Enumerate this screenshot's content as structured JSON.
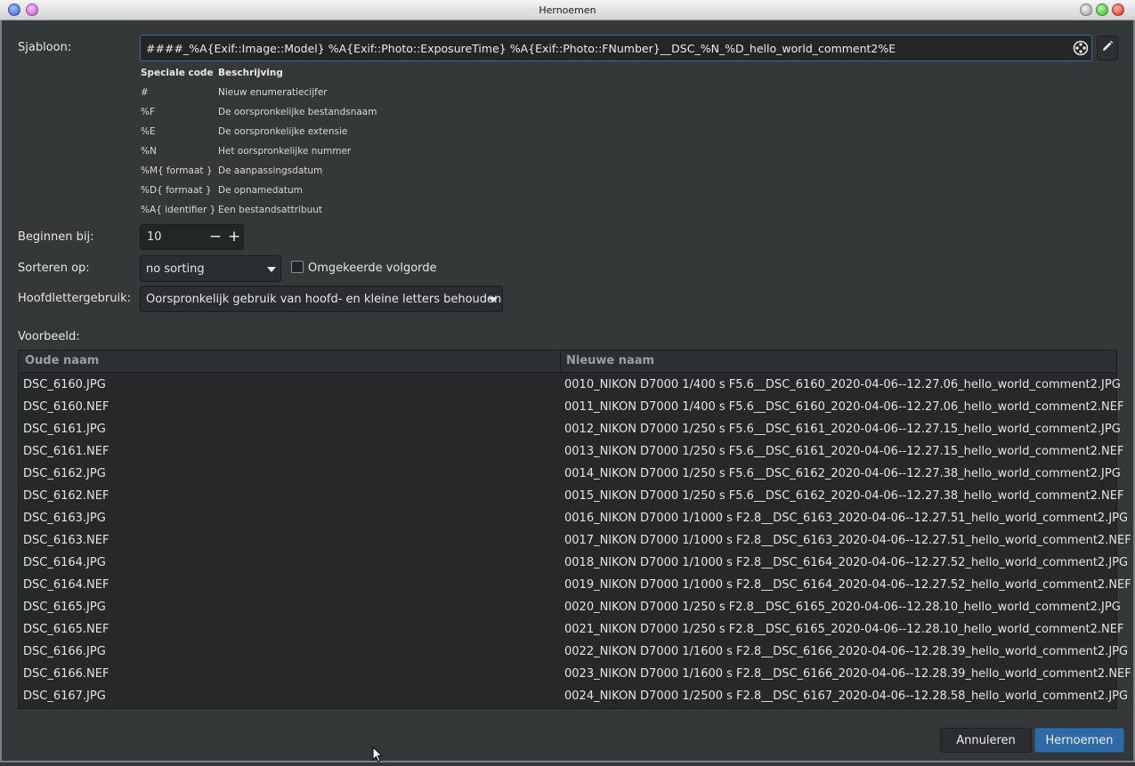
{
  "window": {
    "title": "Hernoemen"
  },
  "form": {
    "template_label": "Sjabloon:",
    "template_value": "####_%A{Exif::Image::Model} %A{Exif::Photo::ExposureTime} %A{Exif::Photo::FNumber}__DSC_%N_%D_hello_world_comment2%E",
    "start_label": "Beginnen bij:",
    "start_value": "10",
    "sort_label": "Sorteren op:",
    "sort_value": "no sorting",
    "reverse_label": "Omgekeerde volgorde",
    "reverse_checked": false,
    "case_label": "Hoofdlettergebruik:",
    "case_value": "Oorspronkelijk gebruik van hoofd- en kleine letters behouden",
    "preview_label": "Voorbeeld:"
  },
  "help": {
    "header_code": "Speciale code",
    "header_desc": "Beschrijving",
    "rows": [
      {
        "code": "#",
        "desc": "Nieuw enumeratiecijfer"
      },
      {
        "code": "%F",
        "desc": "De oorspronkelijke bestandsnaam"
      },
      {
        "code": "%E",
        "desc": "De oorspronkelijke extensie"
      },
      {
        "code": "%N",
        "desc": "Het oorspronkelijke nummer"
      },
      {
        "code": "%M{ formaat }",
        "desc": "De aanpassingsdatum"
      },
      {
        "code": "%D{ formaat }",
        "desc": "De opnamedatum"
      },
      {
        "code": "%A{ identifier }",
        "desc": "Een bestandsattribuut"
      }
    ]
  },
  "preview": {
    "col_old": "Oude naam",
    "col_new": "Nieuwe naam",
    "rows": [
      {
        "old": "DSC_6160.JPG",
        "new": "0010_NIKON D7000 1/400 s F5.6__DSC_6160_2020-04-06--12.27.06_hello_world_comment2.JPG"
      },
      {
        "old": "DSC_6160.NEF",
        "new": "0011_NIKON D7000 1/400 s F5.6__DSC_6160_2020-04-06--12.27.06_hello_world_comment2.NEF"
      },
      {
        "old": "DSC_6161.JPG",
        "new": "0012_NIKON D7000 1/250 s F5.6__DSC_6161_2020-04-06--12.27.15_hello_world_comment2.JPG"
      },
      {
        "old": "DSC_6161.NEF",
        "new": "0013_NIKON D7000 1/250 s F5.6__DSC_6161_2020-04-06--12.27.15_hello_world_comment2.NEF"
      },
      {
        "old": "DSC_6162.JPG",
        "new": "0014_NIKON D7000 1/250 s F5.6__DSC_6162_2020-04-06--12.27.38_hello_world_comment2.JPG"
      },
      {
        "old": "DSC_6162.NEF",
        "new": "0015_NIKON D7000 1/250 s F5.6__DSC_6162_2020-04-06--12.27.38_hello_world_comment2.NEF"
      },
      {
        "old": "DSC_6163.JPG",
        "new": "0016_NIKON D7000 1/1000 s F2.8__DSC_6163_2020-04-06--12.27.51_hello_world_comment2.JPG"
      },
      {
        "old": "DSC_6163.NEF",
        "new": "0017_NIKON D7000 1/1000 s F2.8__DSC_6163_2020-04-06--12.27.51_hello_world_comment2.NEF"
      },
      {
        "old": "DSC_6164.JPG",
        "new": "0018_NIKON D7000 1/1000 s F2.8__DSC_6164_2020-04-06--12.27.52_hello_world_comment2.JPG"
      },
      {
        "old": "DSC_6164.NEF",
        "new": "0019_NIKON D7000 1/1000 s F2.8__DSC_6164_2020-04-06--12.27.52_hello_world_comment2.NEF"
      },
      {
        "old": "DSC_6165.JPG",
        "new": "0020_NIKON D7000 1/250 s F2.8__DSC_6165_2020-04-06--12.28.10_hello_world_comment2.JPG"
      },
      {
        "old": "DSC_6165.NEF",
        "new": "0021_NIKON D7000 1/250 s F2.8__DSC_6165_2020-04-06--12.28.10_hello_world_comment2.NEF"
      },
      {
        "old": "DSC_6166.JPG",
        "new": "0022_NIKON D7000 1/1600 s F2.8__DSC_6166_2020-04-06--12.28.39_hello_world_comment2.JPG"
      },
      {
        "old": "DSC_6166.NEF",
        "new": "0023_NIKON D7000 1/1600 s F2.8__DSC_6166_2020-04-06--12.28.39_hello_world_comment2.NEF"
      },
      {
        "old": "DSC_6167.JPG",
        "new": "0024_NIKON D7000 1/2500 s F2.8__DSC_6167_2020-04-06--12.28.58_hello_world_comment2.JPG"
      }
    ]
  },
  "buttons": {
    "cancel": "Annuleren",
    "ok": "Hernoemen"
  },
  "colors": {
    "background": "#353839",
    "accent": "#2f6aa6",
    "input_focus_border": "#3f6a93"
  },
  "icons": {
    "template_insert": "film-reel-icon",
    "template_edit": "pencil-icon"
  }
}
